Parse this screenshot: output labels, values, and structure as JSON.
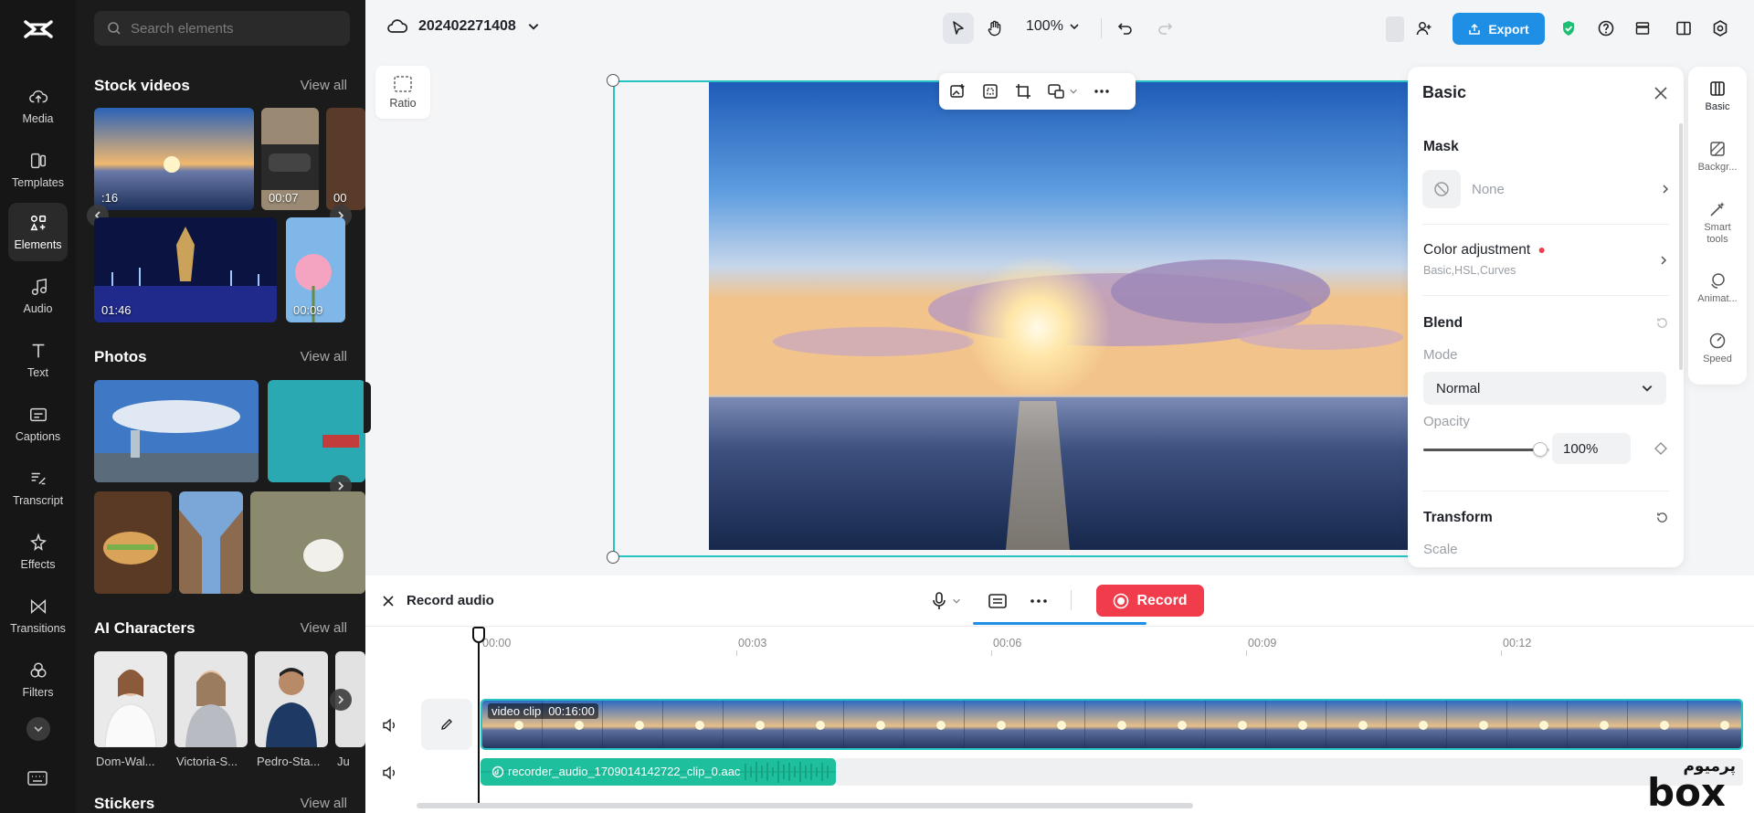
{
  "left_rail": {
    "items": [
      {
        "label": "Media",
        "icon": "cloud-upload-icon"
      },
      {
        "label": "Templates",
        "icon": "templates-icon"
      },
      {
        "label": "Elements",
        "icon": "elements-icon",
        "active": true
      },
      {
        "label": "Audio",
        "icon": "music-note-icon"
      },
      {
        "label": "Text",
        "icon": "text-icon"
      },
      {
        "label": "Captions",
        "icon": "captions-icon"
      },
      {
        "label": "Transcript",
        "icon": "transcript-icon"
      },
      {
        "label": "Effects",
        "icon": "effects-icon"
      },
      {
        "label": "Transitions",
        "icon": "transitions-icon"
      },
      {
        "label": "Filters",
        "icon": "filters-icon"
      }
    ]
  },
  "library": {
    "search_placeholder": "Search elements",
    "stock_videos": {
      "title": "Stock videos",
      "view_all": "View all",
      "durations": [
        ":16",
        "00:07",
        "00",
        "01:46",
        "00:09"
      ]
    },
    "photos": {
      "title": "Photos",
      "view_all": "View all"
    },
    "ai_characters": {
      "title": "AI Characters",
      "view_all": "View all",
      "names": [
        "Dom-Wal...",
        "Victoria-S...",
        "Pedro-Sta...",
        "Ju"
      ]
    },
    "stickers": {
      "title": "Stickers",
      "view_all": "View all"
    }
  },
  "topbar": {
    "project_name": "202402271408",
    "zoom": "100%",
    "export_label": "Export"
  },
  "ratio_label": "Ratio",
  "properties": {
    "title": "Basic",
    "mask": {
      "label": "Mask",
      "value": "None"
    },
    "color_adjustment": {
      "label": "Color adjustment",
      "sub": "Basic,HSL,Curves"
    },
    "blend": {
      "label": "Blend",
      "mode_label": "Mode",
      "mode_value": "Normal",
      "opacity_label": "Opacity",
      "opacity_value": "100%",
      "opacity_level": 1.0
    },
    "transform": {
      "label": "Transform",
      "scale_label": "Scale"
    }
  },
  "right_rail": {
    "items": [
      {
        "label": "Basic",
        "icon": "basic-icon",
        "active": true
      },
      {
        "label": "Backgr...",
        "icon": "background-icon"
      },
      {
        "label": "Smart tools",
        "icon": "magic-wand-icon"
      },
      {
        "label": "Animat...",
        "icon": "animation-icon"
      },
      {
        "label": "Speed",
        "icon": "speed-icon"
      }
    ]
  },
  "record_bar": {
    "title": "Record audio",
    "record_label": "Record"
  },
  "timeline": {
    "ticks": [
      "00:00",
      "00:03",
      "00:06",
      "00:09",
      "00:12"
    ],
    "video_clip_label": "video clip",
    "video_clip_duration": "00:16:00",
    "audio_clip_label": "recorder_audio_1709014142722_clip_0.aac"
  },
  "watermark": {
    "line1": "پرمیوم",
    "line2": "box"
  },
  "colors": {
    "accent": "#1f8fe6",
    "record": "#f03c4b",
    "selection": "#27c3c3",
    "audio_clip": "#1dbf9d"
  }
}
